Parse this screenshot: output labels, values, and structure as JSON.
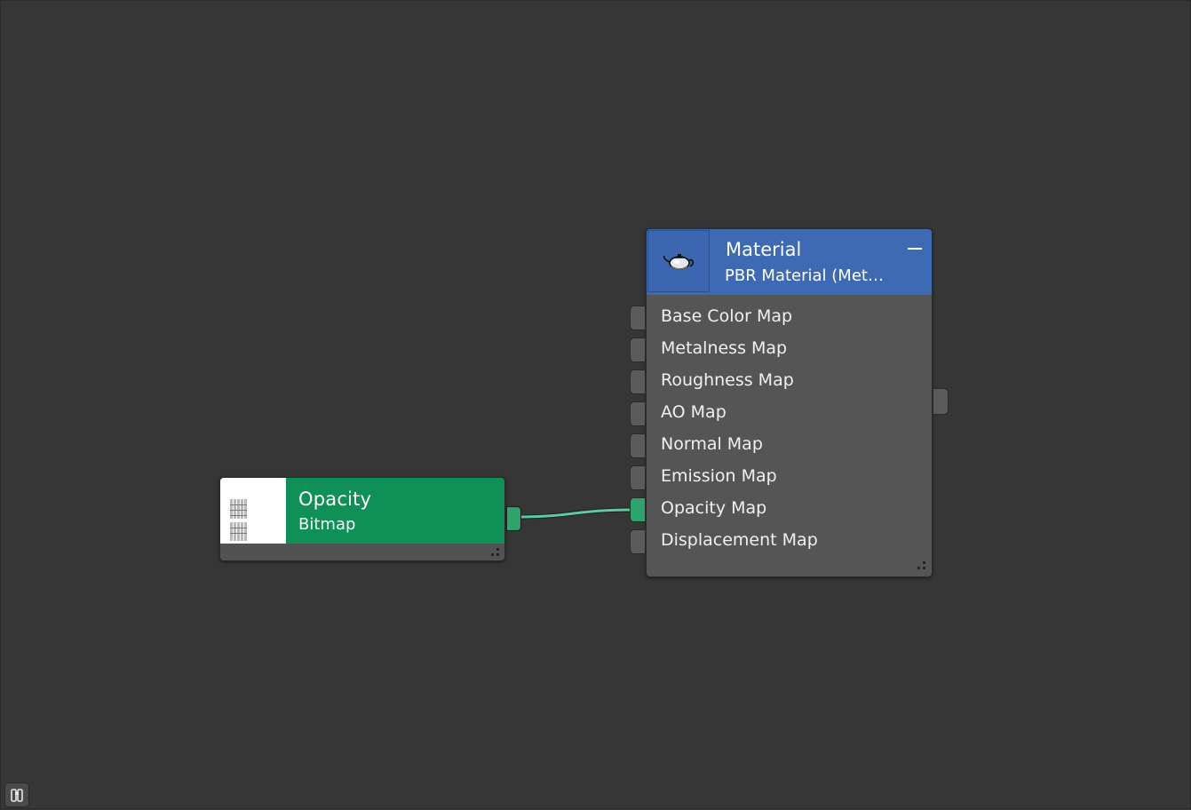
{
  "nodes": {
    "bitmap": {
      "title": "Opacity",
      "subtitle": "Bitmap",
      "header_color": "#0f9057",
      "thumbnail_icon": "bitmap-thumbnail-icon"
    },
    "material": {
      "title": "Material",
      "subtitle": "PBR Material (Met…",
      "header_color": "#3e69b3",
      "icon": "teapot-icon",
      "collapse_icon": "collapse-minus-icon",
      "inputs": [
        {
          "label": "Base Color Map",
          "connected": false
        },
        {
          "label": "Metalness Map",
          "connected": false
        },
        {
          "label": "Roughness Map",
          "connected": false
        },
        {
          "label": "AO Map",
          "connected": false
        },
        {
          "label": "Normal Map",
          "connected": false
        },
        {
          "label": "Emission Map",
          "connected": false
        },
        {
          "label": "Opacity Map",
          "connected": true
        },
        {
          "label": "Displacement Map",
          "connected": false
        }
      ]
    }
  },
  "connections": [
    {
      "from": "bitmap.output",
      "to": "material.Opacity Map",
      "color": "#5fc9a0"
    }
  ],
  "toolbar": {
    "bottom_left_icon": "binoculars-icon"
  }
}
